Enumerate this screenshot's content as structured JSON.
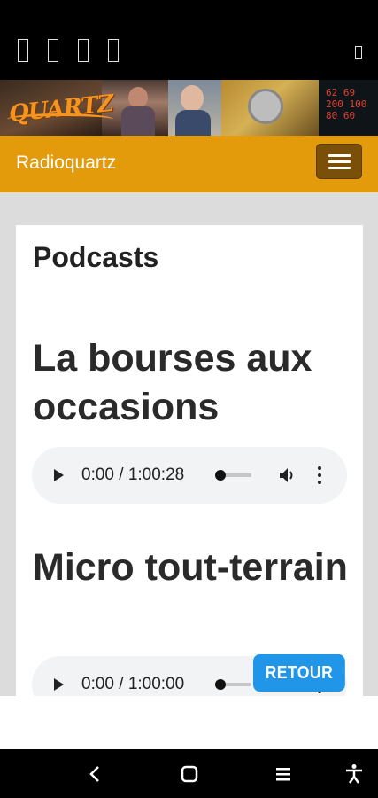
{
  "status_bar": {
    "icons": [
      "status-icon-1",
      "status-icon-2",
      "status-icon-3",
      "status-icon-4",
      "battery-icon"
    ]
  },
  "banner": {
    "logo_text": "QUARTZ"
  },
  "navbar": {
    "brand": "Radioquartz",
    "menu_icon": "hamburger-icon"
  },
  "content": {
    "section_title": "Podcasts",
    "podcasts": [
      {
        "title": "La bourses aux occasions",
        "time": "0:00 / 1:00:28",
        "progress": 0
      },
      {
        "title": "Micro tout-terrain",
        "time": "0:00 / 1:00:00",
        "progress": 0
      }
    ]
  },
  "floating_button": {
    "label": "RETOUR"
  },
  "system_nav": {
    "icons": [
      "back-icon",
      "home-icon",
      "recents-icon",
      "accessibility-icon"
    ]
  },
  "colors": {
    "navbar": "#e39b0b",
    "toggler": "#7a5008",
    "retour": "#2196e8",
    "background": "#dcdcdc"
  }
}
